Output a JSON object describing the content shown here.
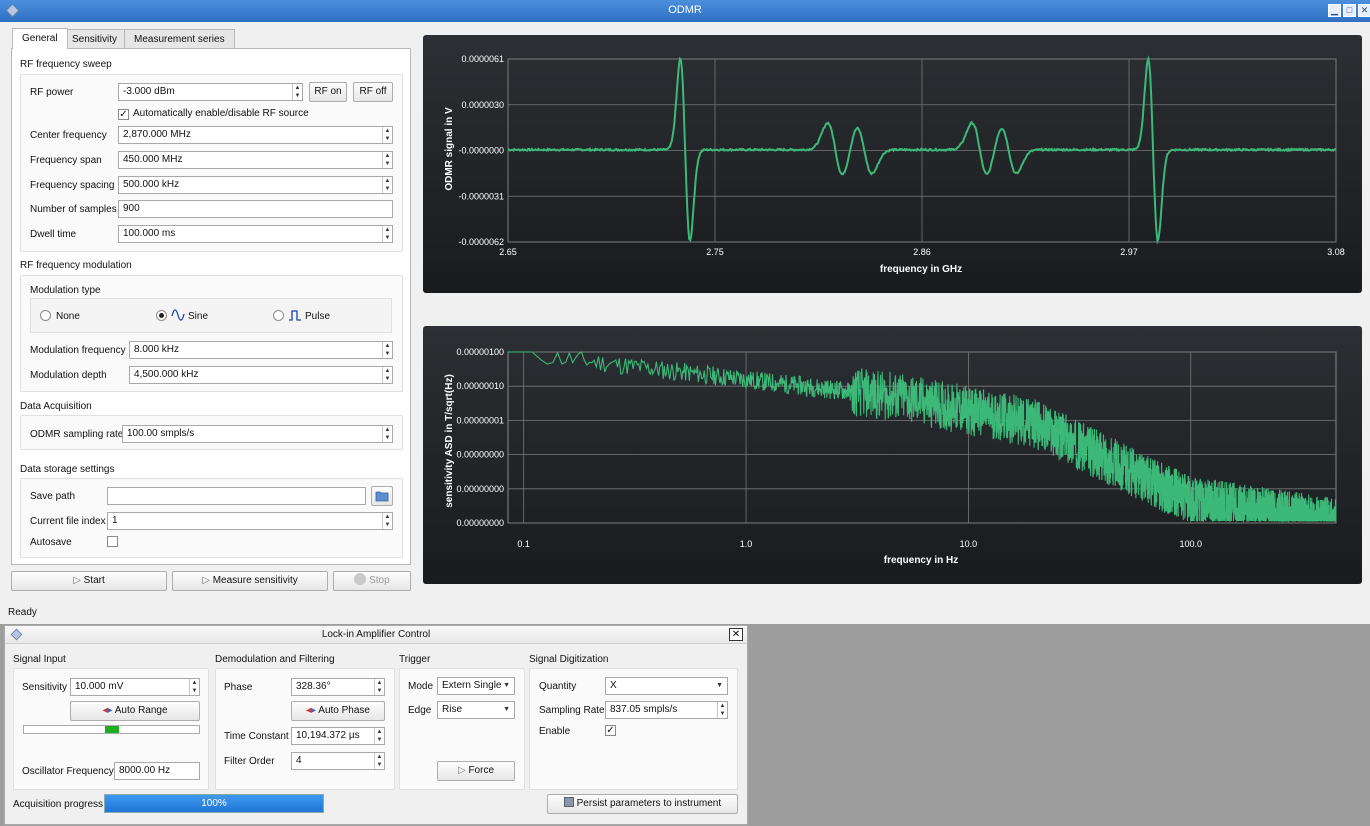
{
  "window": {
    "title": "ODMR"
  },
  "tabs": [
    {
      "label": "General"
    },
    {
      "label": "Sensitivity"
    },
    {
      "label": "Measurement series"
    }
  ],
  "rf_sweep": {
    "title": "RF frequency sweep",
    "rf_power_label": "RF power",
    "rf_power_value": "-3.000 dBm",
    "rf_on_label": "RF on",
    "rf_off_label": "RF off",
    "auto_enable_label": "Automatically enable/disable RF source",
    "center_freq_label": "Center frequency",
    "center_freq_value": "2,870.000 MHz",
    "span_label": "Frequency span",
    "span_value": "450.000 MHz",
    "spacing_label": "Frequency spacing",
    "spacing_value": "500.000 kHz",
    "samples_label": "Number of samples",
    "samples_value": "900",
    "dwell_label": "Dwell time",
    "dwell_value": "100.000 ms"
  },
  "modulation": {
    "title": "RF frequency modulation",
    "type_label": "Modulation type",
    "options": [
      "None",
      "Sine",
      "Pulse"
    ],
    "selected": "Sine",
    "freq_label": "Modulation frequency",
    "freq_value": "8.000 kHz",
    "depth_label": "Modulation depth",
    "depth_value": "4,500.000 kHz"
  },
  "acquisition": {
    "title": "Data Acquisition",
    "rate_label": "ODMR sampling rate",
    "rate_value": "100.00 smpls/s"
  },
  "storage": {
    "title": "Data storage settings",
    "save_path_label": "Save path",
    "save_path_value": "",
    "file_index_label": "Current file index",
    "file_index_value": "1",
    "autosave_label": "Autosave"
  },
  "actions": {
    "start_label": "Start",
    "measure_label": "Measure sensitivity",
    "stop_label": "Stop"
  },
  "status": {
    "text": "Ready"
  },
  "odmr_plot": {
    "chart_data": {
      "type": "line",
      "xlabel": "frequency in GHz",
      "ylabel": "ODMR signal in V",
      "xlim": [
        2.65,
        3.08
      ],
      "ylim": [
        -6.2e-06,
        6.1e-06
      ],
      "x_ticks": [
        "2.65",
        "2.75",
        "2.86",
        "2.97",
        "3.08"
      ],
      "y_ticks": [
        "0.0000061",
        "0.0000030",
        "-0.0000000",
        "-0.0000031",
        "-0.0000062"
      ],
      "grid": true,
      "line_color": "#3cb878",
      "peaks": [
        {
          "center": 2.742,
          "amplitude": 6.1e-06,
          "width": 0.0025
        },
        {
          "center": 2.82,
          "amplitude": 1.8e-06,
          "width": 0.004
        },
        {
          "center": 2.835,
          "amplitude": 1.6e-06,
          "width": 0.004
        },
        {
          "center": 2.895,
          "amplitude": 1.8e-06,
          "width": 0.004
        },
        {
          "center": 2.91,
          "amplitude": 1.6e-06,
          "width": 0.004
        },
        {
          "center": 2.985,
          "amplitude": 6.1e-06,
          "width": 0.0025
        }
      ]
    }
  },
  "sensitivity_plot": {
    "chart_data": {
      "type": "line",
      "xlabel": "frequency in Hz",
      "ylabel": "sensitivity ASD in T/sqrt(Hz)",
      "xscale": "log",
      "xlim": [
        0.085,
        450
      ],
      "x_ticks": [
        "0.1",
        "1.0",
        "10.0",
        "100.0"
      ],
      "y_ticks": [
        "0.00000100",
        "0.00000010",
        "0.00000001",
        "0.00000000",
        "0.00000000",
        "0.00000000"
      ],
      "grid": true,
      "line_color": "#3cb878",
      "trend": [
        {
          "f": 0.085,
          "level": 1e-06
        },
        {
          "f": 5,
          "level": 1.5e-07
        },
        {
          "f": 20,
          "level": 5e-08
        },
        {
          "f": 100,
          "level": 2e-09
        },
        {
          "f": 450,
          "level": 8e-10
        }
      ]
    }
  },
  "lockin": {
    "title": "Lock-in Amplifier Control",
    "signal_input": {
      "title": "Signal Input",
      "sensitivity_label": "Sensitivity",
      "sensitivity_value": "10.000 mV",
      "auto_range_label": "Auto Range",
      "level_fraction": 0.5,
      "osc_freq_label": "Oscillator Frequency",
      "osc_freq_value": "8000.00 Hz"
    },
    "demod": {
      "title": "Demodulation and Filtering",
      "phase_label": "Phase",
      "phase_value": "328.36°",
      "auto_phase_label": "Auto Phase",
      "tc_label": "Time Constant",
      "tc_value": "10,194.372 µs",
      "order_label": "Filter Order",
      "order_value": "4"
    },
    "trigger": {
      "title": "Trigger",
      "mode_label": "Mode",
      "mode_value": "Extern Single",
      "edge_label": "Edge",
      "edge_value": "Rise",
      "force_label": "Force"
    },
    "digitization": {
      "title": "Signal Digitization",
      "quantity_label": "Quantity",
      "quantity_value": "X",
      "rate_label": "Sampling Rate",
      "rate_value": "837.05 smpls/s",
      "enable_label": "Enable"
    },
    "progress_label": "Acquisition progress",
    "progress_value": 100,
    "progress_text": "100%",
    "persist_label": "Persist parameters to instrument"
  }
}
